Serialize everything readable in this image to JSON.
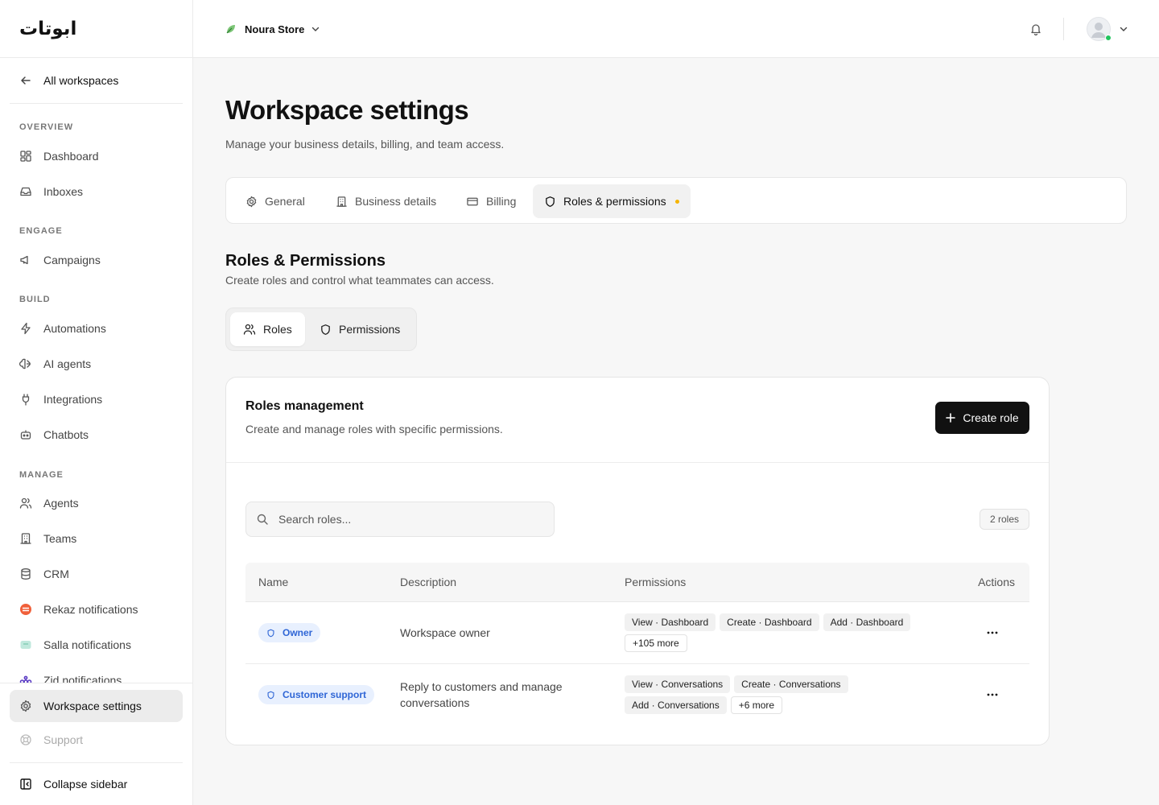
{
  "brand": {
    "logo_text": "ابوتات"
  },
  "sidebar": {
    "back_label": "All workspaces",
    "sections": {
      "overview": "OVERVIEW",
      "engage": "ENGAGE",
      "build": "BUILD",
      "manage": "MANAGE"
    },
    "items": {
      "dashboard": "Dashboard",
      "inboxes": "Inboxes",
      "campaigns": "Campaigns",
      "automations": "Automations",
      "ai_agents": "AI agents",
      "integrations": "Integrations",
      "chatbots": "Chatbots",
      "agents": "Agents",
      "teams": "Teams",
      "crm": "CRM",
      "rekaz": "Rekaz notifications",
      "salla": "Salla notifications",
      "zid": "Zid notifications"
    },
    "workspace_settings": "Workspace settings",
    "support": "Support",
    "collapse": "Collapse sidebar"
  },
  "topbar": {
    "store_name": "Noura Store",
    "avatar_status": "online"
  },
  "page": {
    "title": "Workspace settings",
    "subtitle": "Manage your business details, billing, and team access."
  },
  "tabs": {
    "general": "General",
    "business": "Business details",
    "billing": "Billing",
    "roles": "Roles & permissions"
  },
  "roles_section": {
    "title": "Roles & Permissions",
    "subtitle": "Create roles and control what teammates can access.",
    "seg_roles": "Roles",
    "seg_permissions": "Permissions"
  },
  "card": {
    "title": "Roles management",
    "subtitle": "Create and manage roles with specific permissions.",
    "create_label": "Create role",
    "search_placeholder": "Search roles...",
    "count": "2 roles",
    "columns": {
      "name": "Name",
      "description": "Description",
      "permissions": "Permissions",
      "actions": "Actions"
    },
    "rows": [
      {
        "name": "Owner",
        "description": "Workspace owner",
        "permissions": [
          "View · Dashboard",
          "Create · Dashboard",
          "Add · Dashboard"
        ],
        "more": "+105 more"
      },
      {
        "name": "Customer support",
        "description": "Reply to customers and manage conversations",
        "permissions": [
          "View · Conversations",
          "Create · Conversations",
          "Add · Conversations"
        ],
        "more": "+6 more"
      }
    ]
  },
  "colors": {
    "accent": "#111111",
    "badge_bg": "#e8f0fe",
    "badge_text": "#2f66d6",
    "tab_dot": "#f5b400",
    "online": "#22c55e"
  }
}
